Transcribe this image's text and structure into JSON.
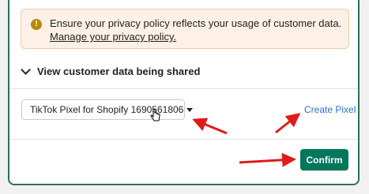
{
  "banner": {
    "icon": "warning-icon",
    "text": "Ensure your privacy policy reflects your usage of customer data.",
    "link": "Manage your privacy policy."
  },
  "disclosure": {
    "icon": "chevron-down-icon",
    "label": "View customer data being shared"
  },
  "pixel_select": {
    "value": "TikTok Pixel for Shopify 1690561806",
    "icon": "caret-down-icon"
  },
  "create_pixel": {
    "label": "Create Pixel"
  },
  "confirm": {
    "label": "Confirm"
  },
  "colors": {
    "primary": "#00775a",
    "frame_border": "#2f6f55",
    "link": "#2c6ecb",
    "annotation_arrow": "#e01b1b",
    "banner_bg": "#fdf1e7",
    "warning_icon": "#b98900"
  }
}
